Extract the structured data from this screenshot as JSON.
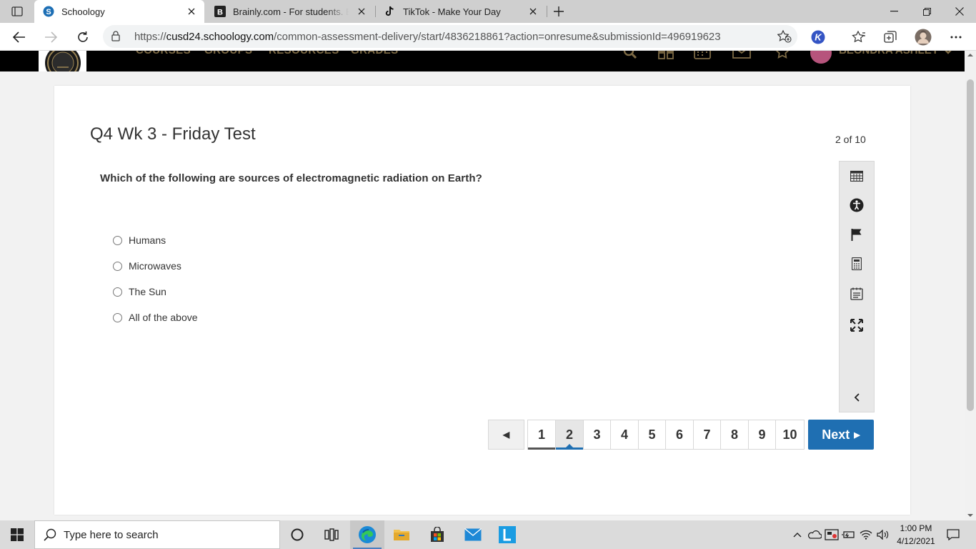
{
  "browser": {
    "tabs": [
      {
        "title": "Schoology",
        "active": true
      },
      {
        "title": "Brainly.com - For students. By students."
      },
      {
        "title": "TikTok - Make Your Day"
      }
    ],
    "url": {
      "prefix": "https://",
      "host": "cusd24.schoology.com",
      "path": "/common-assessment-delivery/start/4836218861?action=onresume&submissionId=496919623"
    }
  },
  "site_nav": {
    "links": [
      "COURSES",
      "GROUPS",
      "RESOURCES",
      "GRADES"
    ],
    "user_name": "BEONDRA ASHLEY"
  },
  "assessment": {
    "title": "Q4 Wk 3 - Friday Test",
    "progress": "2 of 10",
    "question": "Which of the following are sources of electromagnetic radiation on Earth?",
    "options": [
      "Humans",
      "Microwaves",
      "The Sun",
      "All of the above"
    ]
  },
  "tools": [
    "calendar-icon",
    "accessibility-icon",
    "flag-icon",
    "calculator-icon",
    "notepad-icon",
    "fullscreen-icon",
    "collapse-chevron-icon"
  ],
  "pagination": {
    "prev_symbol": "◀",
    "pages": [
      "1",
      "2",
      "3",
      "4",
      "5",
      "6",
      "7",
      "8",
      "9",
      "10"
    ],
    "current": "2",
    "next_label": "Next",
    "next_symbol": "▶"
  },
  "taskbar": {
    "search_placeholder": "Type here to search",
    "apps": [
      "cortana-icon",
      "task-view-icon",
      "edge-icon",
      "file-explorer-icon",
      "store-icon",
      "mail-icon",
      "launcher-l-icon"
    ],
    "time": "1:00 PM",
    "date": "4/12/2021"
  },
  "colors": {
    "accent_blue": "#1f6fb2",
    "nav_black": "#000000",
    "nav_gold": "#7d6a45"
  }
}
